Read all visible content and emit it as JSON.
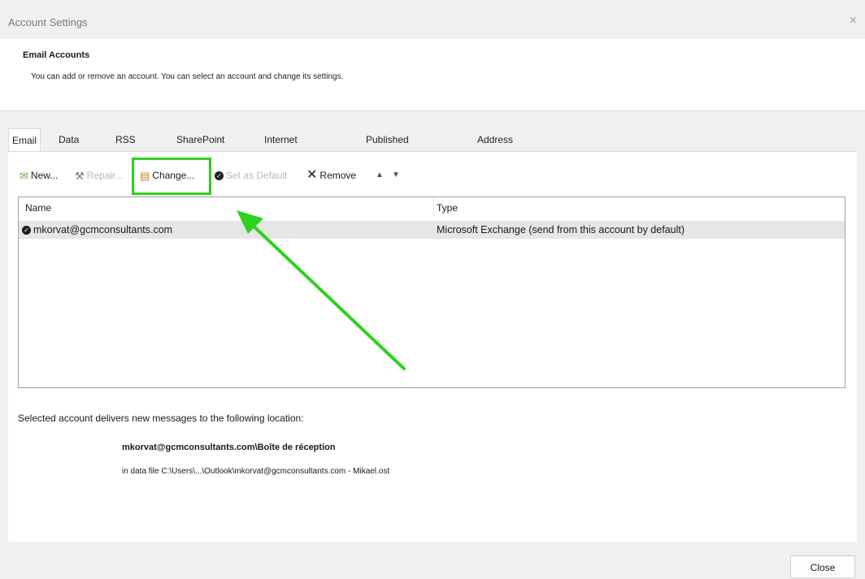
{
  "window": {
    "title": "Account Settings",
    "close_glyph": "×"
  },
  "header": {
    "title": "Email Accounts",
    "description": "You can add or remove an account. You can select an account and change its settings."
  },
  "tabs": [
    {
      "label": "Email",
      "active": true
    },
    {
      "label": "Data Files"
    },
    {
      "label": "RSS Feeds"
    },
    {
      "label": "SharePoint Lists"
    },
    {
      "label": "Internet Calendars"
    },
    {
      "label": "Published Calendars"
    },
    {
      "label": "Address Books"
    }
  ],
  "toolbar": {
    "new_label": "New...",
    "repair_label": "Repair...",
    "change_label": "Change...",
    "set_default_label": "Set as Default",
    "remove_label": "Remove"
  },
  "accounts_list": {
    "columns": [
      "Name",
      "Type"
    ],
    "rows": [
      {
        "name": "mkorvat@gcmconsultants.com",
        "type": "Microsoft Exchange (send from this account by default)"
      }
    ]
  },
  "delivery": {
    "text": "Selected account delivers new messages to the following location:",
    "location": "mkorvat@gcmconsultants.com\\Boîte de réception",
    "data_file": "in data file C:\\Users\\...\\Outlook\\mkorvat@gcmconsultants.com - Mikael.ost"
  },
  "footer": {
    "close_label": "Close"
  },
  "annotation": {
    "highlight_color": "#2ed11e"
  }
}
